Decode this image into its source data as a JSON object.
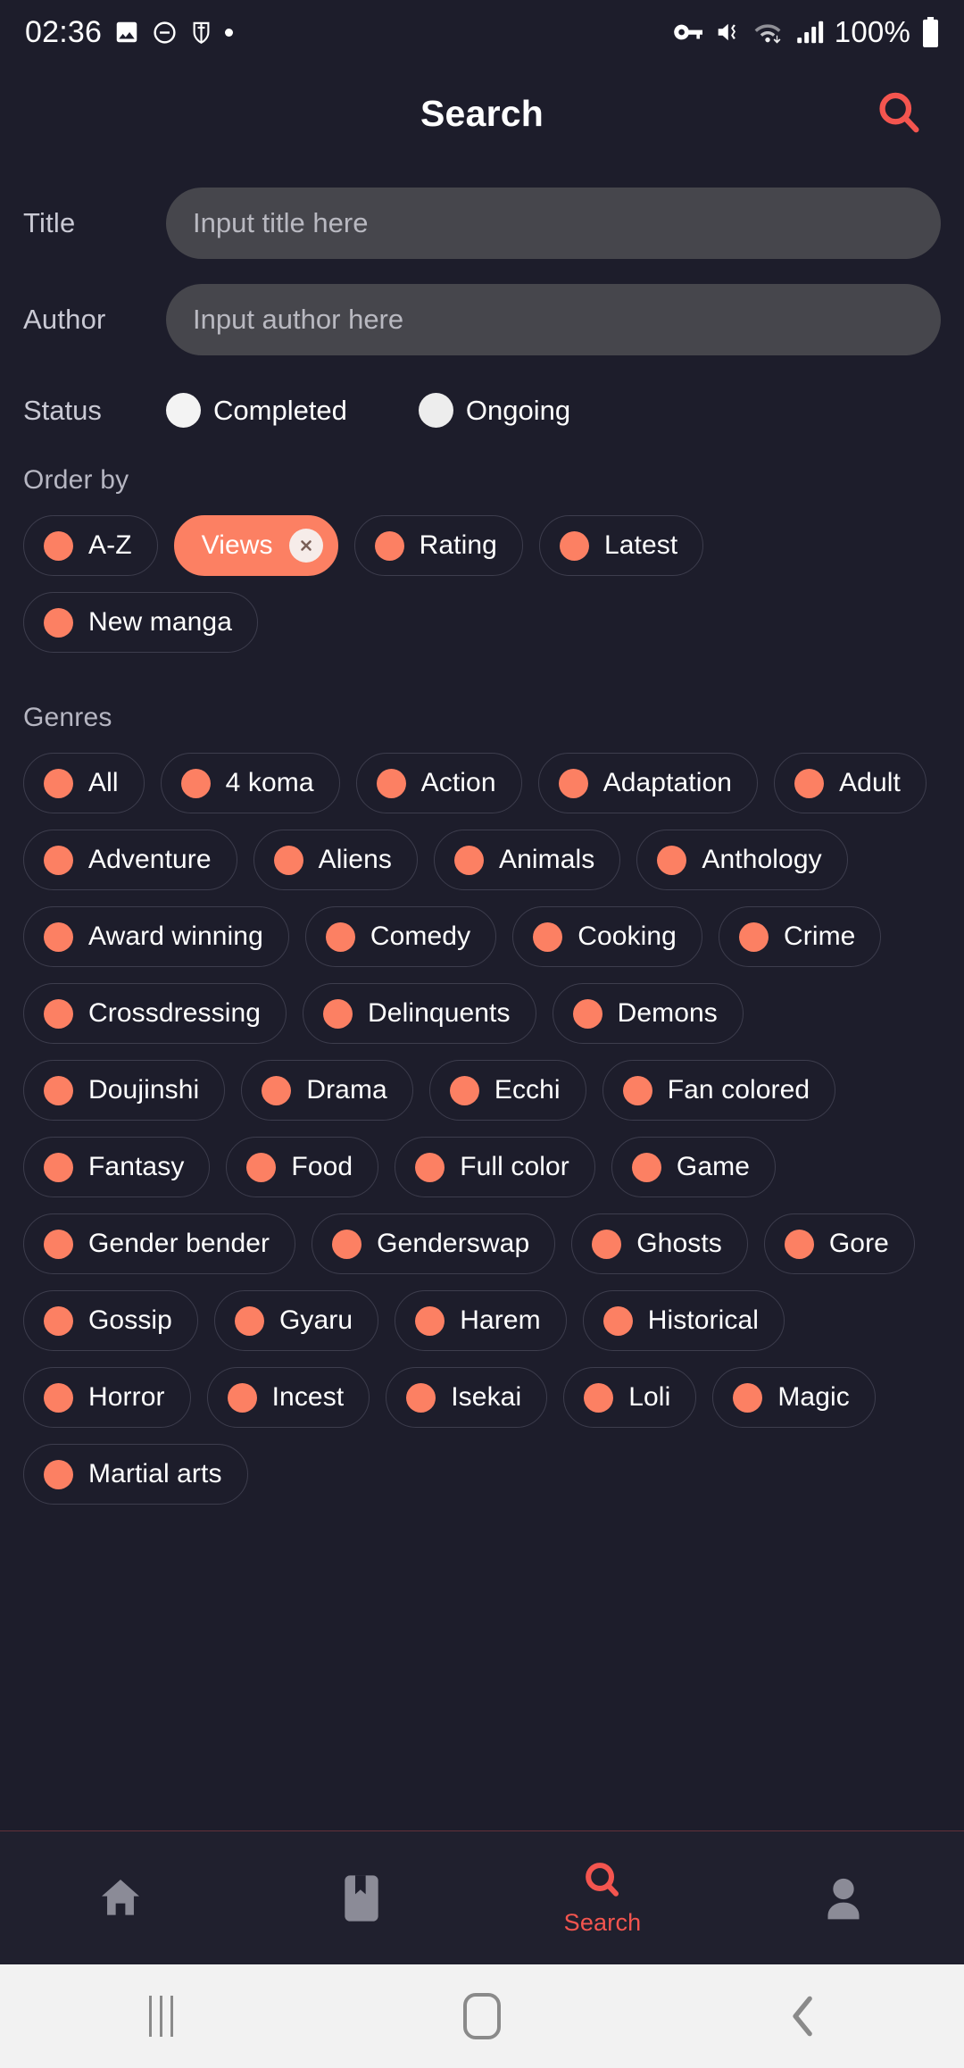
{
  "statusbar": {
    "clock": "02:36",
    "battery_percent": "100%",
    "left_icons": [
      "image-icon",
      "do-not-disturb-icon",
      "shield-person-icon",
      "dot-icon"
    ],
    "right_icons": [
      "vpn-key-icon",
      "mute-vibrate-icon",
      "wifi-transfer-icon",
      "signal-bars-icon",
      "battery-icon"
    ]
  },
  "appbar": {
    "title": "Search",
    "search_icon": "search-icon",
    "accent_color": "#f4554f"
  },
  "theme": {
    "background": "#1d1d2b",
    "chip_accent": "#fc8063",
    "input_background": "#46464c",
    "nav_background": "#20202e"
  },
  "form": {
    "title": {
      "label": "Title",
      "value": "",
      "placeholder": "Input title here"
    },
    "author": {
      "label": "Author",
      "value": "",
      "placeholder": "Input author here"
    },
    "status": {
      "label": "Status",
      "options": [
        {
          "label": "Completed",
          "selected": false
        },
        {
          "label": "Ongoing",
          "selected": false
        }
      ]
    }
  },
  "order_by": {
    "title": "Order by",
    "chips": [
      {
        "label": "A-Z",
        "selected": false
      },
      {
        "label": "Views",
        "selected": true
      },
      {
        "label": "Rating",
        "selected": false
      },
      {
        "label": "Latest",
        "selected": false
      },
      {
        "label": "New manga",
        "selected": false
      }
    ]
  },
  "genres": {
    "title": "Genres",
    "chips": [
      {
        "label": "All",
        "selected": false
      },
      {
        "label": "4 koma",
        "selected": false
      },
      {
        "label": "Action",
        "selected": false
      },
      {
        "label": "Adaptation",
        "selected": false
      },
      {
        "label": "Adult",
        "selected": false
      },
      {
        "label": "Adventure",
        "selected": false
      },
      {
        "label": "Aliens",
        "selected": false
      },
      {
        "label": "Animals",
        "selected": false
      },
      {
        "label": "Anthology",
        "selected": false
      },
      {
        "label": "Award winning",
        "selected": false
      },
      {
        "label": "Comedy",
        "selected": false
      },
      {
        "label": "Cooking",
        "selected": false
      },
      {
        "label": "Crime",
        "selected": false
      },
      {
        "label": "Crossdressing",
        "selected": false
      },
      {
        "label": "Delinquents",
        "selected": false
      },
      {
        "label": "Demons",
        "selected": false
      },
      {
        "label": "Doujinshi",
        "selected": false
      },
      {
        "label": "Drama",
        "selected": false
      },
      {
        "label": "Ecchi",
        "selected": false
      },
      {
        "label": "Fan colored",
        "selected": false
      },
      {
        "label": "Fantasy",
        "selected": false
      },
      {
        "label": "Food",
        "selected": false
      },
      {
        "label": "Full color",
        "selected": false
      },
      {
        "label": "Game",
        "selected": false
      },
      {
        "label": "Gender bender",
        "selected": false
      },
      {
        "label": "Genderswap",
        "selected": false
      },
      {
        "label": "Ghosts",
        "selected": false
      },
      {
        "label": "Gore",
        "selected": false
      },
      {
        "label": "Gossip",
        "selected": false
      },
      {
        "label": "Gyaru",
        "selected": false
      },
      {
        "label": "Harem",
        "selected": false
      },
      {
        "label": "Historical",
        "selected": false
      },
      {
        "label": "Horror",
        "selected": false
      },
      {
        "label": "Incest",
        "selected": false
      },
      {
        "label": "Isekai",
        "selected": false
      },
      {
        "label": "Loli",
        "selected": false
      },
      {
        "label": "Magic",
        "selected": false
      },
      {
        "label": "Martial arts",
        "selected": false
      }
    ]
  },
  "bottom_nav": {
    "items": [
      {
        "label": "",
        "icon": "home-icon",
        "active": false
      },
      {
        "label": "",
        "icon": "bookmark-icon",
        "active": false
      },
      {
        "label": "Search",
        "icon": "search-icon",
        "active": true
      },
      {
        "label": "",
        "icon": "person-icon",
        "active": false
      }
    ],
    "active_color": "#f4554f",
    "inactive_color": "#8b8b97"
  },
  "android_nav": {
    "recents_label": "recents-icon",
    "home_label": "home-icon",
    "back_label": "back-icon"
  }
}
